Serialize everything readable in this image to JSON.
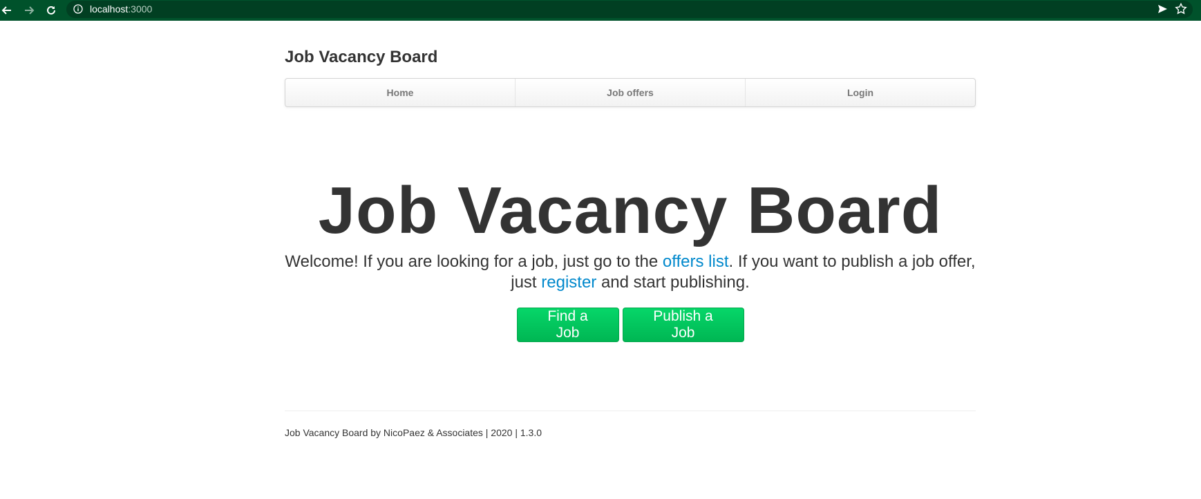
{
  "browser": {
    "url_host": "localhost",
    "url_port": ":3000"
  },
  "header": {
    "brand": "Job Vacancy Board"
  },
  "navbar": {
    "items": [
      {
        "label": "Home"
      },
      {
        "label": "Job offers"
      },
      {
        "label": "Login"
      }
    ]
  },
  "hero": {
    "title": "Job Vacancy Board",
    "lead_part1": "Welcome! If you are looking for a job, just go to the ",
    "offers_link": "offers list",
    "lead_part2": ". If you want to publish a job offer, just ",
    "register_link": "register",
    "lead_part3": " and start publishing.",
    "find_button": "Find a Job",
    "publish_button": "Publish a Job"
  },
  "footer": {
    "text": "Job Vacancy Board by NicoPaez & Associates | 2020 | 1.3.0"
  },
  "colors": {
    "chrome": "#00522b",
    "link": "#0088cc",
    "button": "#00c15e"
  }
}
